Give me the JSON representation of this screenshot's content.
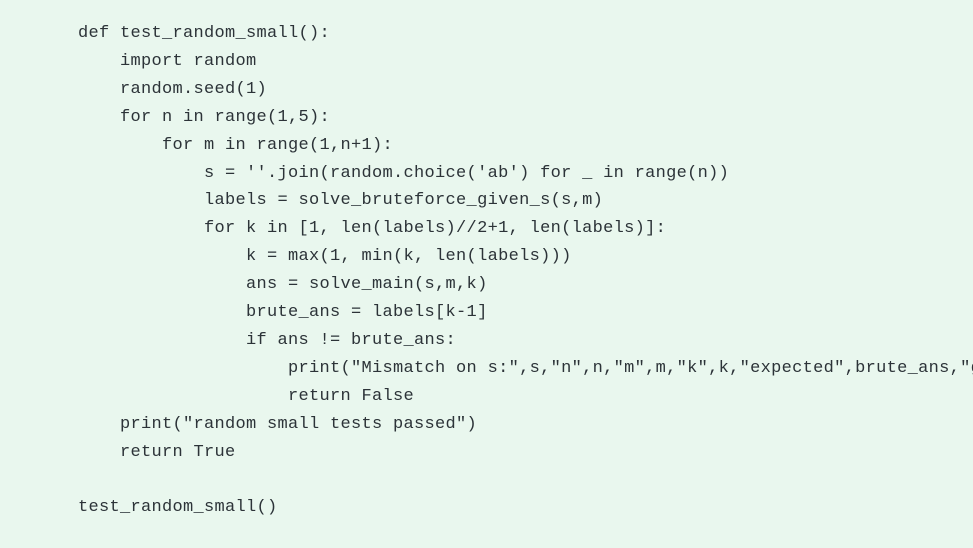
{
  "code": {
    "lines": [
      "def test_random_small():",
      "    import random",
      "    random.seed(1)",
      "    for n in range(1,5):",
      "        for m in range(1,n+1):",
      "            s = ''.join(random.choice('ab') for _ in range(n))",
      "            labels = solve_bruteforce_given_s(s,m)",
      "            for k in [1, len(labels)//2+1, len(labels)]:",
      "                k = max(1, min(k, len(labels)))",
      "                ans = solve_main(s,m,k)",
      "                brute_ans = labels[k-1]",
      "                if ans != brute_ans:",
      "                    print(\"Mismatch on s:\",s,\"n\",n,\"m\",m,\"k\",k,\"expected\",brute_ans,\"g",
      "                    return False",
      "    print(\"random small tests passed\")",
      "    return True",
      "",
      "test_random_small()"
    ]
  }
}
